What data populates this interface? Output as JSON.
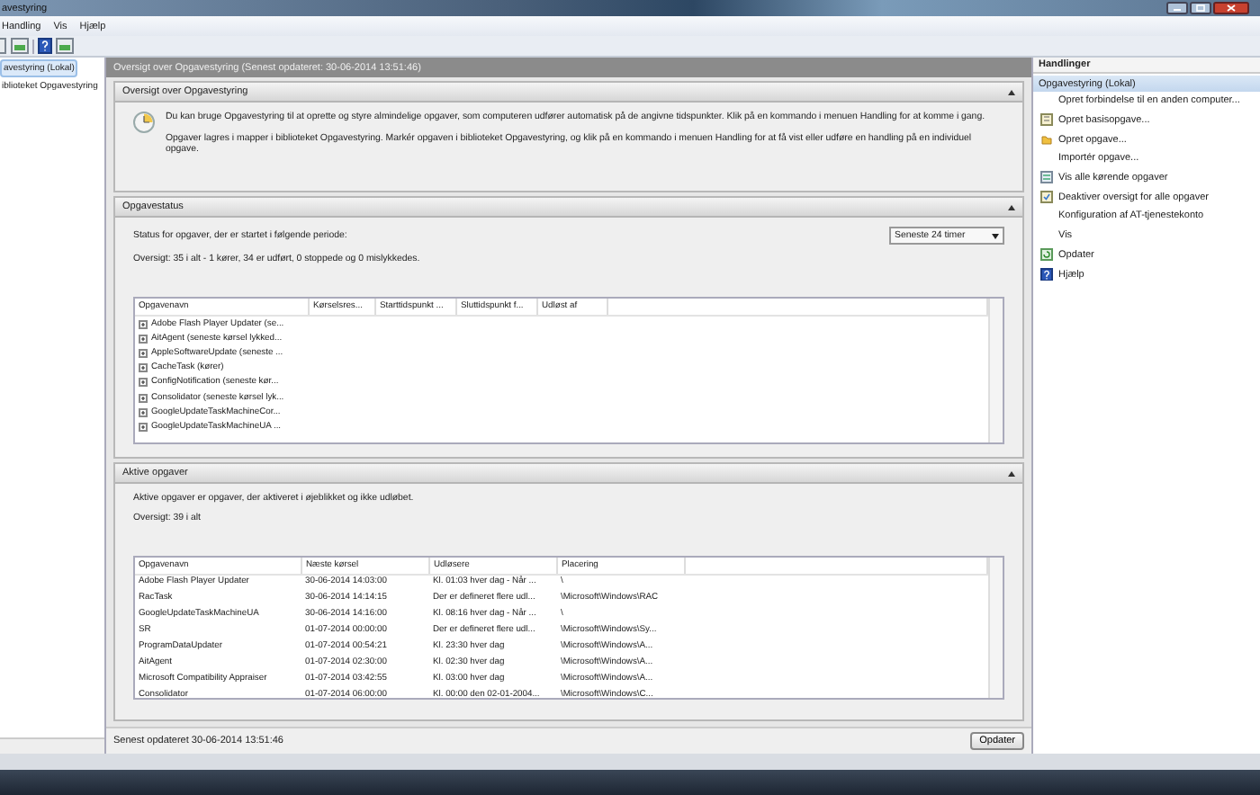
{
  "window": {
    "title": "avestyring"
  },
  "menu": [
    "Handling",
    "Vis",
    "Hjælp"
  ],
  "tree": [
    {
      "label": "avestyring (Lokal)",
      "selected": true
    },
    {
      "label": "iblioteket Opgavestyring",
      "selected": false
    }
  ],
  "center": {
    "header": "Oversigt over Opgavestyring  (Senest opdateret: 30-06-2014 13:51:46)",
    "overview": {
      "title": "Oversigt over Opgavestyring",
      "paragraphs": [
        "Du kan bruge Opgavestyring til at oprette og styre almindelige opgaver, som computeren udfører automatisk på de angivne tidspunkter. Klik på en kommando i menuen Handling for at komme i gang.",
        "Opgaver lagres i mapper i biblioteket Opgavestyring. Markér opgaven i biblioteket Opgavestyring, og klik på en kommando i menuen Handling for at få vist eller udføre en handling på en individuel opgave."
      ]
    },
    "status": {
      "title": "Opgavestatus",
      "label": "Status for opgaver, der er startet i følgende periode:",
      "period": "Seneste 24 timer",
      "summary": "Oversigt: 35 i alt - 1 kører, 34 er udført, 0 stoppede og 0 mislykkedes.",
      "columns": [
        "Opgavenavn",
        "Kørselsres...",
        "Starttidspunkt ...",
        "Sluttidspunkt f...",
        "Udløst af"
      ],
      "rows": [
        "Adobe Flash Player Updater (se...",
        "AitAgent (seneste kørsel lykked...",
        "AppleSoftwareUpdate (seneste ...",
        "CacheTask (kører)",
        "ConfigNotification (seneste kør...",
        "Consolidator (seneste kørsel lyk...",
        "GoogleUpdateTaskMachineCor...",
        "GoogleUpdateTaskMachineUA ..."
      ]
    },
    "active": {
      "title": "Aktive opgaver",
      "description": "Aktive opgaver er opgaver, der aktiveret i øjeblikket og ikke udløbet.",
      "summary": "Oversigt: 39 i alt",
      "columns": [
        "Opgavenavn",
        "Næste kørsel",
        "Udløsere",
        "Placering"
      ],
      "rows": [
        [
          "Adobe Flash Player Updater",
          "30-06-2014 14:03:00",
          "Kl. 01:03 hver dag - Når ...",
          "\\"
        ],
        [
          "RacTask",
          "30-06-2014 14:14:15",
          "Der er defineret flere udl...",
          "\\Microsoft\\Windows\\RAC"
        ],
        [
          "GoogleUpdateTaskMachineUA",
          "30-06-2014 14:16:00",
          "Kl. 08:16 hver dag - Når ...",
          "\\"
        ],
        [
          "SR",
          "01-07-2014 00:00:00",
          "Der er defineret flere udl...",
          "\\Microsoft\\Windows\\Sy..."
        ],
        [
          "ProgramDataUpdater",
          "01-07-2014 00:54:21",
          "Kl. 23:30 hver dag",
          "\\Microsoft\\Windows\\A..."
        ],
        [
          "AitAgent",
          "01-07-2014 02:30:00",
          "Kl. 02:30 hver dag",
          "\\Microsoft\\Windows\\A..."
        ],
        [
          "Microsoft Compatibility Appraiser",
          "01-07-2014 03:42:55",
          "Kl. 03:00 hver dag",
          "\\Microsoft\\Windows\\A..."
        ],
        [
          "Consolidator",
          "01-07-2014 06:00:00",
          "Kl. 00:00 den 02-01-2004...",
          "\\Microsoft\\Windows\\C..."
        ]
      ]
    },
    "footer": {
      "text": "Senest opdateret 30-06-2014 13:51:46",
      "button": "Opdater"
    }
  },
  "actions": {
    "title": "Handlinger",
    "group": "Opgavestyring (Lokal)",
    "items": [
      {
        "label": "Opret forbindelse til en anden computer...",
        "kind": "plain"
      },
      {
        "label": "Opret basisopgave...",
        "kind": "wizard"
      },
      {
        "label": "Opret opgave...",
        "kind": "task"
      },
      {
        "label": "Importér opgave...",
        "kind": "plain"
      },
      {
        "label": "Vis alle kørende opgaver",
        "kind": "list"
      },
      {
        "label": "Deaktiver oversigt for alle opgaver",
        "kind": "toggle"
      },
      {
        "label": "Konfiguration af AT-tjenestekonto",
        "kind": "plain"
      },
      {
        "label": "Vis",
        "kind": "plain"
      },
      {
        "label": "Opdater",
        "kind": "refresh"
      },
      {
        "label": "Hjælp",
        "kind": "help"
      }
    ]
  }
}
